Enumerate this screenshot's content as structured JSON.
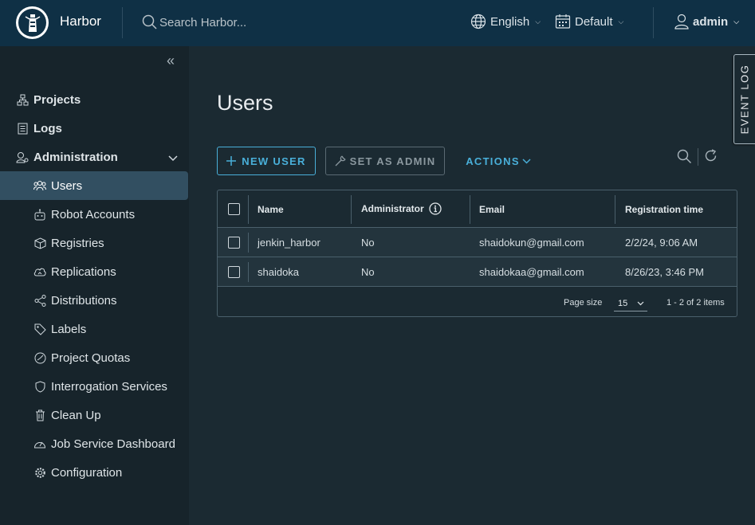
{
  "header": {
    "brand": "Harbor",
    "search_placeholder": "Search Harbor...",
    "language": "English",
    "theme": "Default",
    "user": "admin"
  },
  "sidebar": {
    "items": [
      {
        "label": "Projects",
        "icon": "projects-icon"
      },
      {
        "label": "Logs",
        "icon": "logs-icon"
      },
      {
        "label": "Administration",
        "icon": "administration-icon"
      },
      {
        "label": "Users",
        "icon": "users-icon"
      },
      {
        "label": "Robot Accounts",
        "icon": "robot-icon"
      },
      {
        "label": "Registries",
        "icon": "registries-icon"
      },
      {
        "label": "Replications",
        "icon": "replications-icon"
      },
      {
        "label": "Distributions",
        "icon": "distributions-icon"
      },
      {
        "label": "Labels",
        "icon": "labels-icon"
      },
      {
        "label": "Project Quotas",
        "icon": "quota-icon"
      },
      {
        "label": "Interrogation Services",
        "icon": "shield-icon"
      },
      {
        "label": "Clean Up",
        "icon": "trash-icon"
      },
      {
        "label": "Job Service Dashboard",
        "icon": "dashboard-icon"
      },
      {
        "label": "Configuration",
        "icon": "gear-icon"
      }
    ]
  },
  "event_log": "EVENT LOG",
  "page": {
    "title": "Users",
    "new_user": "NEW USER",
    "set_as_admin": "SET AS ADMIN",
    "actions": "ACTIONS"
  },
  "table": {
    "columns": [
      "Name",
      "Administrator",
      "Email",
      "Registration time"
    ],
    "rows": [
      {
        "name": "jenkin_harbor",
        "admin": "No",
        "email": "shaidokun@gmail.com",
        "registered": "2/2/24, 9:06 AM"
      },
      {
        "name": "shaidoka",
        "admin": "No",
        "email": "shaidokaa@gmail.com",
        "registered": "8/26/23, 3:46 PM"
      }
    ],
    "page_size_label": "Page size",
    "page_size": "15",
    "pagination": "1 - 2 of 2 items"
  },
  "colors": {
    "header_bg": "#0f3045",
    "sidebar_bg": "#17242b",
    "main_bg": "#1b2a32",
    "accent": "#49afd9",
    "active_nav": "#324f61"
  }
}
